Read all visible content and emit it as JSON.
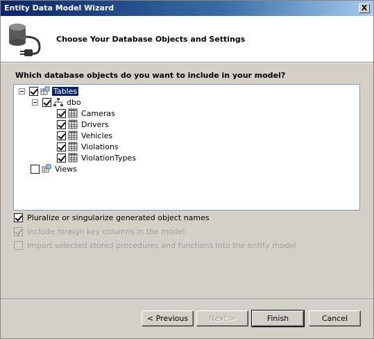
{
  "window": {
    "title": "Entity Data Model Wizard",
    "close_label": "X"
  },
  "header": {
    "title": "Choose Your Database Objects and Settings",
    "icon": "database-plug-icon"
  },
  "question": "Which database objects do you want to include in your model?",
  "tree": {
    "tables": {
      "label": "Tables",
      "checked": true,
      "expanded": true,
      "selected": true
    },
    "dbo": {
      "label": "dbo",
      "checked": true,
      "expanded": true
    },
    "items": [
      {
        "label": "Cameras",
        "checked": true
      },
      {
        "label": "Drivers",
        "checked": true
      },
      {
        "label": "Vehicles",
        "checked": true
      },
      {
        "label": "Violations",
        "checked": true
      },
      {
        "label": "ViolationTypes",
        "checked": true
      }
    ],
    "views": {
      "label": "Views",
      "checked": false
    }
  },
  "options": {
    "pluralize": {
      "label": "Pluralize or singularize generated object names",
      "checked": true,
      "enabled": true
    },
    "foreign_keys": {
      "label": "Include foreign key columns in the model",
      "checked": true,
      "enabled": false
    },
    "import_procs": {
      "label": "Import selected stored procedures and functions into the entity model",
      "checked": false,
      "enabled": false
    }
  },
  "buttons": {
    "previous": "< Previous",
    "next": "Next >",
    "finish": "Finish",
    "cancel": "Cancel"
  }
}
